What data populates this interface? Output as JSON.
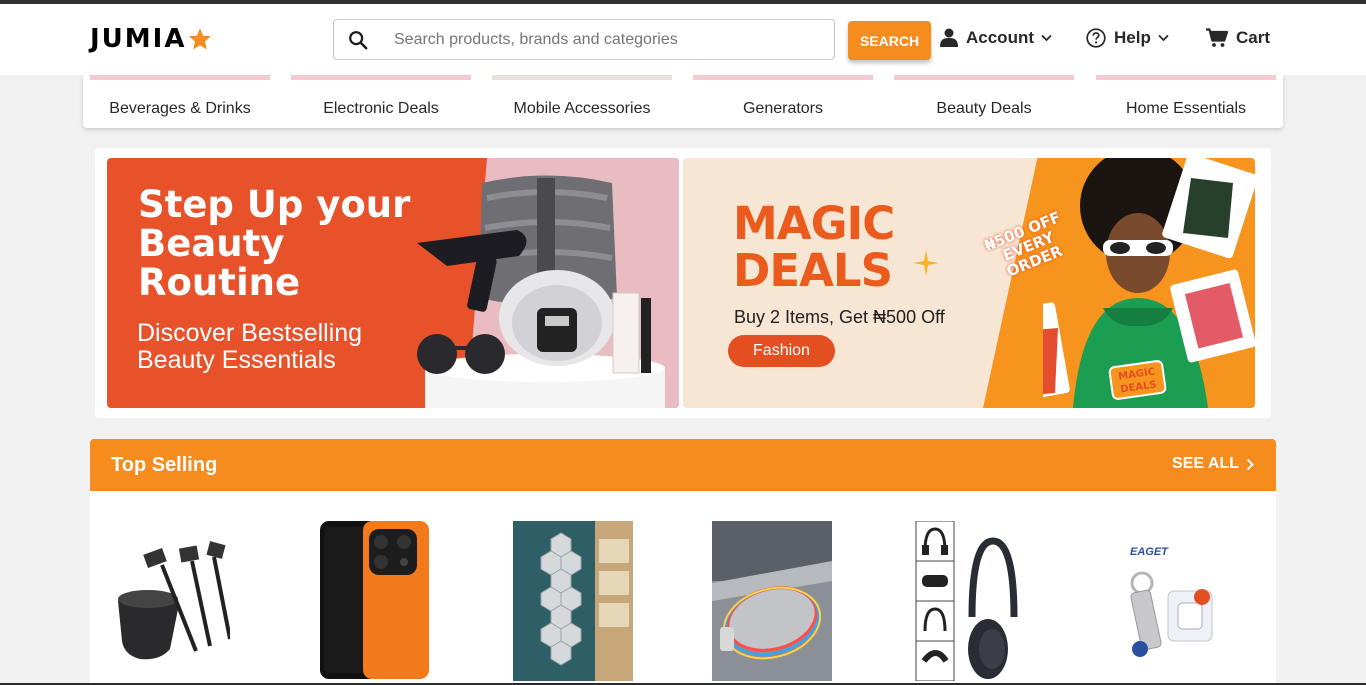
{
  "header": {
    "logo_text": "JUMIA",
    "search": {
      "placeholder": "Search products, brands and categories",
      "button_label": "SEARCH"
    },
    "nav": {
      "account": "Account",
      "help": "Help",
      "cart": "Cart"
    }
  },
  "categories": [
    {
      "label": "Beverages & Drinks"
    },
    {
      "label": "Electronic Deals"
    },
    {
      "label": "Mobile Accessories"
    },
    {
      "label": "Generators"
    },
    {
      "label": "Beauty Deals"
    },
    {
      "label": "Home Essentials"
    }
  ],
  "banners": {
    "left": {
      "title": "Step Up your Beauty Routine",
      "subtitle": "Discover Bestselling Beauty Essentials"
    },
    "right": {
      "title": "MAGIC DEALS",
      "subtitle": "Buy 2 Items, Get ₦500 Off",
      "pill": "Fashion",
      "stamp": "₦500 OFF EVERY ORDER",
      "badge": "MAGIC DEALS"
    }
  },
  "top_selling": {
    "title": "Top Selling",
    "see_all": "SEE ALL"
  },
  "products": [
    {
      "icon": "hair-dye-brush-set-image"
    },
    {
      "icon": "orange-smartphone-image"
    },
    {
      "icon": "hexagon-mirror-stickers-image"
    },
    {
      "icon": "rgb-wireless-mouse-image"
    },
    {
      "icon": "bluetooth-headphones-image"
    },
    {
      "icon": "usb-flash-drive-image"
    }
  ],
  "colors": {
    "brand_orange": "#f68b1e",
    "banner_left_bg": "#e8522b",
    "banner_right_bg": "#f7e6d3",
    "magic_deals_text": "#ea5b1d"
  }
}
